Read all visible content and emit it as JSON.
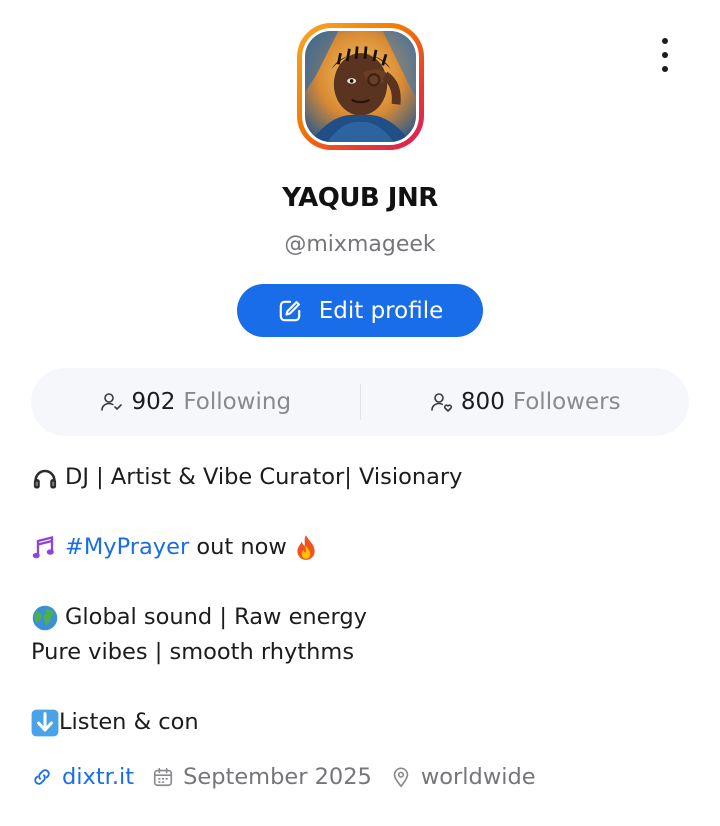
{
  "profile": {
    "display_name": "YAQUB JNR",
    "username": "@mixmageek",
    "edit_button_label": "Edit profile"
  },
  "stats": {
    "following_count": "902",
    "following_label": "Following",
    "followers_count": "800",
    "followers_label": "Followers"
  },
  "bio": {
    "line1": "DJ | Artist & Vibe Curator| Visionary",
    "line2_hashtag": "#MyPrayer",
    "line2_rest": " out now",
    "line3": "Global sound | Raw energy",
    "line4": "Pure vibes | smooth rhythms",
    "line5": "Listen & con"
  },
  "meta": {
    "website": "dixtr.it",
    "joined": "September 2025",
    "location": "worldwide"
  },
  "colors": {
    "accent": "#1a6de8",
    "muted": "#76767a",
    "stats_bg": "#f5f7fa"
  },
  "icons": {
    "more": "more-vertical-icon",
    "edit": "edit-icon",
    "following": "user-check-icon",
    "followers": "user-heart-icon",
    "link": "link-icon",
    "calendar": "calendar-icon",
    "location": "location-pin-icon"
  }
}
